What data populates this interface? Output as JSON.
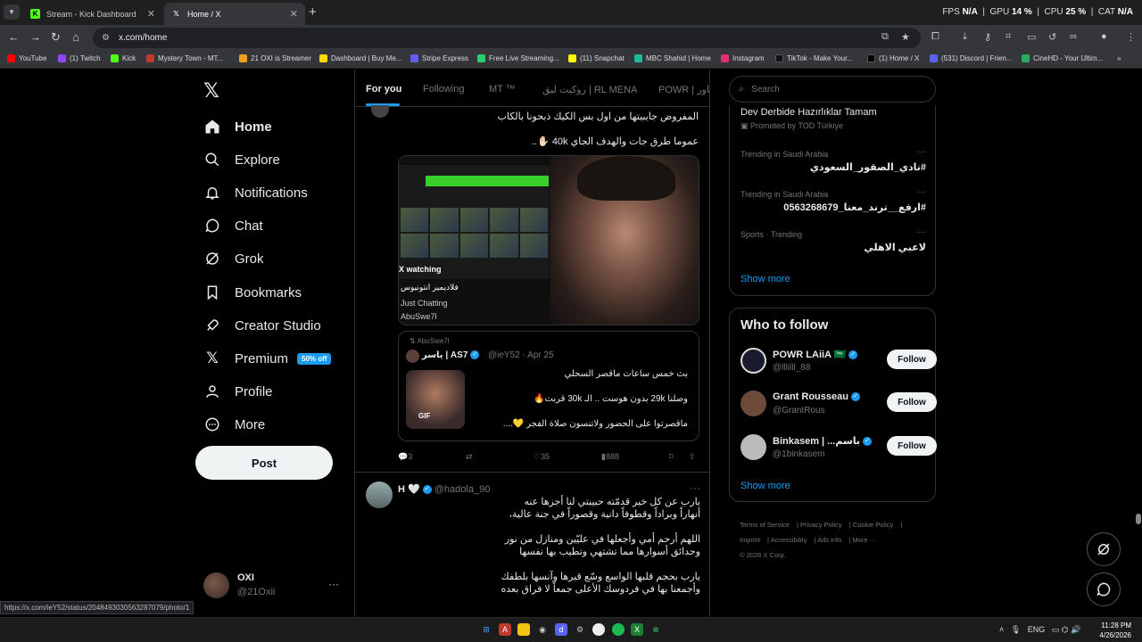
{
  "browser": {
    "tabs": [
      {
        "title": "Stream - Kick Dashboard",
        "active": false
      },
      {
        "title": "Home / X",
        "active": true
      }
    ],
    "url": "x.com/home",
    "perf": {
      "fps_label": "FPS",
      "fps": "N/A",
      "gpu_label": "GPU",
      "gpu": "14 %",
      "cpu_label": "CPU",
      "cpu": "25 %",
      "cat_label": "CAT",
      "cat": "N/A"
    },
    "bookmarks": [
      {
        "label": "YouTube",
        "color": "#ff0000"
      },
      {
        "label": "(1) Twitch",
        "color": "#9146ff"
      },
      {
        "label": "Kick",
        "color": "#53fc18"
      },
      {
        "label": "Mystery Town - MT...",
        "color": "#c0392b"
      },
      {
        "label": "21 OXI is Streamer",
        "color": "#f0a020"
      },
      {
        "label": "Dashboard | Buy Me...",
        "color": "#ffdd00"
      },
      {
        "label": "Stripe Express",
        "color": "#635bff"
      },
      {
        "label": "Free Live Streaming...",
        "color": "#2ecc71"
      },
      {
        "label": "(11) Snapchat",
        "color": "#fffc00"
      },
      {
        "label": "MBC Shahid | Home",
        "color": "#1abc9c"
      },
      {
        "label": "Instagram",
        "color": "#e1306c"
      },
      {
        "label": "TikTok - Make Your...",
        "color": "#111111"
      },
      {
        "label": "(1) Home / X",
        "color": "#000000"
      },
      {
        "label": "(531) Discord | Frien...",
        "color": "#5865f2"
      },
      {
        "label": "CineHD - Your Ultim...",
        "color": "#27ae60"
      }
    ],
    "status_url": "https://x.com/ieY52/status/2048493030563287079/photo/1"
  },
  "nav": {
    "items": [
      {
        "label": "Home",
        "icon": "home-icon"
      },
      {
        "label": "Explore",
        "icon": "search-icon"
      },
      {
        "label": "Notifications",
        "icon": "bell-icon"
      },
      {
        "label": "Chat",
        "icon": "chat-icon"
      },
      {
        "label": "Grok",
        "icon": "grok-icon"
      },
      {
        "label": "Bookmarks",
        "icon": "bookmark-icon"
      },
      {
        "label": "Creator Studio",
        "icon": "rocket-icon"
      },
      {
        "label": "Premium",
        "icon": "x-icon"
      },
      {
        "label": "Profile",
        "icon": "person-icon"
      },
      {
        "label": "More",
        "icon": "more-icon"
      }
    ],
    "premium_badge": "50% off",
    "post_label": "Post",
    "account": {
      "name": "OXI",
      "handle": "@21Oxii"
    }
  },
  "timeline": {
    "tabs": [
      "For you",
      "Following",
      "MT ™",
      "روكيت ليق | RL MENA",
      "POWR | باور"
    ],
    "tweet1": {
      "line1": "المفروض جايبيتها من اول بس الكيك ذبحونا بالكاب",
      "line2": "عموما طرق جات والهدف الجاي 40k ✋🏻..",
      "media": {
        "watching": "X watching",
        "stream_title": "فلاديمير انتونيوس",
        "category": "Just Chatting",
        "user": "AbuSwe7l"
      },
      "quote": {
        "reposted_by": "AbuSwe7l",
        "name": "ياسر | AS7",
        "handle": "@ieY52 · Apr 25",
        "gif": "GIF",
        "line1": "بث خمس ساعات ماقصر السحلي",
        "line2": "وصلنا 29k بدون هوست .. الـ 30k قربت🔥",
        "line3": "ماقصرتوا على الحضور ولاتنسون صلاة الفجر 💛...."
      },
      "actions": {
        "replies": "3",
        "reposts": "",
        "likes": "35",
        "views": "888"
      }
    },
    "tweet2": {
      "name": "H 🤍",
      "handle": "@hadola_90",
      "lines": [
        "يارب عن كل خير قدمّته حبيبتي لنا أجزها عنه",
        "أنهاراً وبراداً وقطوفاً دانية وقصوراً في جنة عالية،",
        "اللهم أرحم أمي وأجعلها في عليّين ومنازل من نور",
        "وحدائق أسوارها مما تشتهي وتطيب بها نفسها",
        "يارب بحجم قلبها الواسع وسّع قبرها وآنسها بلطفك",
        "وأجمعنا بها في فردوسك الأعلى جمعاً لا فراق بعده"
      ]
    }
  },
  "sidebar": {
    "search_placeholder": "Search",
    "promo": "Dev Derbide Hazırlıklar Tamam",
    "promo_by": "Promoted by TOD Türkiye",
    "trends": [
      {
        "category": "Trending in Saudi Arabia",
        "topic": "#نادي_الصقور_السعودي"
      },
      {
        "category": "Trending in Saudi Arabia",
        "topic": "#ارفع__ترند_معنا_0563268679"
      },
      {
        "category": "Sports · Trending",
        "topic": "لاعبي الاهلي"
      }
    ],
    "show_more": "Show more",
    "who_to_follow": {
      "title": "Who to follow",
      "accounts": [
        {
          "name": "POWR LAiiA 🇸🇦",
          "handle": "@lllilll_88",
          "color": "#1a1a2e"
        },
        {
          "name": "Grant Rousseau",
          "handle": "@GrantRous",
          "color": "#6b4a3a"
        },
        {
          "name": "Binkasem | ...باسم",
          "handle": "@1binkasem",
          "color": "#bbbbbb"
        }
      ],
      "follow_label": "Follow",
      "show_more": "Show more"
    },
    "footer": [
      "Terms of Service",
      "Privacy Policy",
      "Cookie Policy",
      "Imprint",
      "Accessibility",
      "Ads info",
      "More ···",
      "© 2026 X Corp."
    ]
  },
  "taskbar": {
    "time": "11:28 PM",
    "date": "4/26/2026",
    "lang": "ENG"
  }
}
